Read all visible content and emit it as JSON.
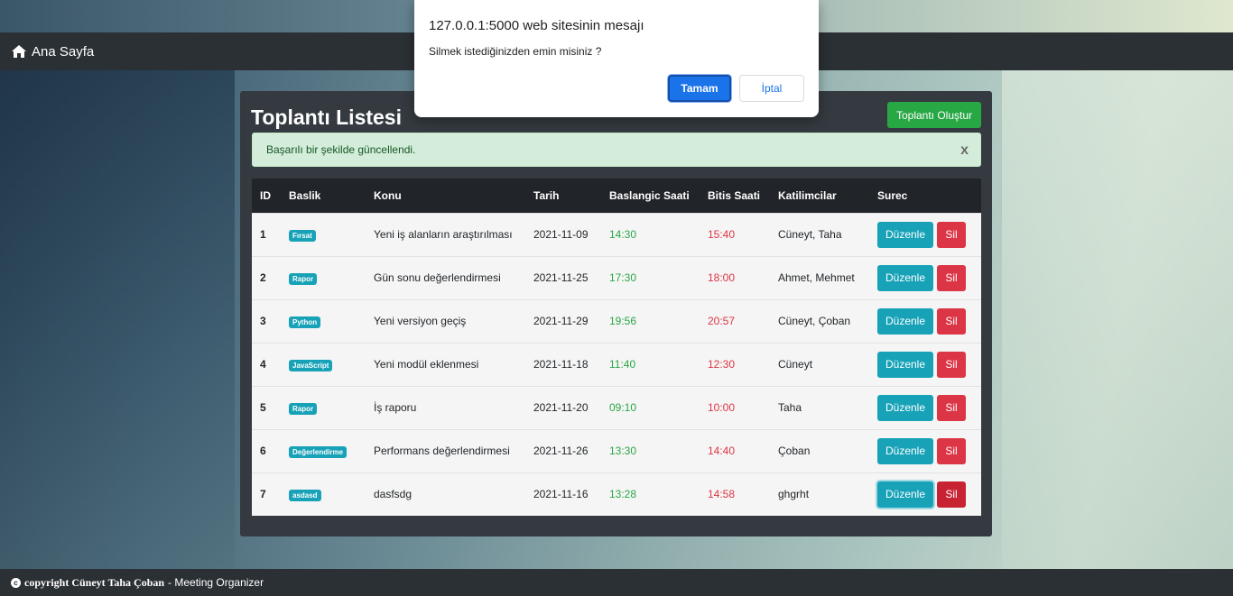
{
  "navbar": {
    "home_label": "Ana Sayfa"
  },
  "panel": {
    "title_light": "Toplantı ",
    "title_bold": "Listesi",
    "create_button": "Toplantı Oluştur"
  },
  "alert": {
    "message": "Başarılı bir şekilde güncellendi.",
    "close": "x"
  },
  "table": {
    "headers": [
      "ID",
      "Baslik",
      "Konu",
      "Tarih",
      "Baslangic Saati",
      "Bitis Saati",
      "Katilimcilar",
      "Surec"
    ],
    "edit_label": "Düzenle",
    "delete_label": "Sil",
    "rows": [
      {
        "id": "1",
        "tag": "Fırsat",
        "topic": "Yeni iş alanların araştırılması",
        "date": "2021-11-09",
        "start": "14:30",
        "end": "15:40",
        "participants": "Cüneyt, Taha"
      },
      {
        "id": "2",
        "tag": "Rapor",
        "topic": "Gün sonu değerlendirmesi",
        "date": "2021-11-25",
        "start": "17:30",
        "end": "18:00",
        "participants": "Ahmet, Mehmet"
      },
      {
        "id": "3",
        "tag": "Python",
        "topic": "Yeni versiyon geçiş",
        "date": "2021-11-29",
        "start": "19:56",
        "end": "20:57",
        "participants": "Cüneyt, Çoban"
      },
      {
        "id": "4",
        "tag": "JavaScript",
        "topic": "Yeni modül eklenmesi",
        "date": "2021-11-18",
        "start": "11:40",
        "end": "12:30",
        "participants": "Cüneyt"
      },
      {
        "id": "5",
        "tag": "Rapor",
        "topic": "İş raporu",
        "date": "2021-11-20",
        "start": "09:10",
        "end": "10:00",
        "participants": "Taha"
      },
      {
        "id": "6",
        "tag": "Değerlendirme",
        "topic": "Performans değerlendirmesi",
        "date": "2021-11-26",
        "start": "13:30",
        "end": "14:40",
        "participants": "Çoban"
      },
      {
        "id": "7",
        "tag": "asdasd",
        "topic": "dasfsdg",
        "date": "2021-11-16",
        "start": "13:28",
        "end": "14:58",
        "participants": "ghgrht"
      }
    ]
  },
  "footer": {
    "author": "copyright Cüneyt Taha Çoban",
    "suffix": "- Meeting Organizer"
  },
  "dialog": {
    "title": "127.0.0.1:5000 web sitesinin mesajı",
    "message": "Silmek istediğinizden emin misiniz ?",
    "ok": "Tamam",
    "cancel": "İptal"
  },
  "colors": {
    "success": "#28a745",
    "danger": "#dc3545",
    "info": "#17a2b8",
    "dark": "#343a40",
    "primary": "#1a73e8"
  }
}
